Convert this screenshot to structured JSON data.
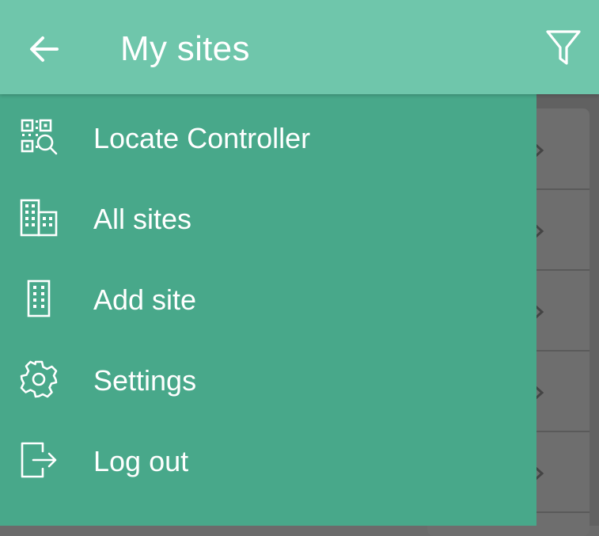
{
  "appbar": {
    "title": "My sites",
    "back_icon": "arrow-left-icon",
    "filter_icon": "filter-icon"
  },
  "drawer": {
    "items": [
      {
        "label": "Locate Controller",
        "icon": "qr-search-icon"
      },
      {
        "label": "All sites",
        "icon": "buildings-icon"
      },
      {
        "label": "Add site",
        "icon": "building-icon"
      },
      {
        "label": "Settings",
        "icon": "gear-icon"
      },
      {
        "label": "Log out",
        "icon": "logout-icon"
      }
    ]
  },
  "colors": {
    "appbar": "#6fc6ab",
    "drawer": "#48a88a",
    "scrim": "#616161",
    "text": "#ffffff"
  }
}
